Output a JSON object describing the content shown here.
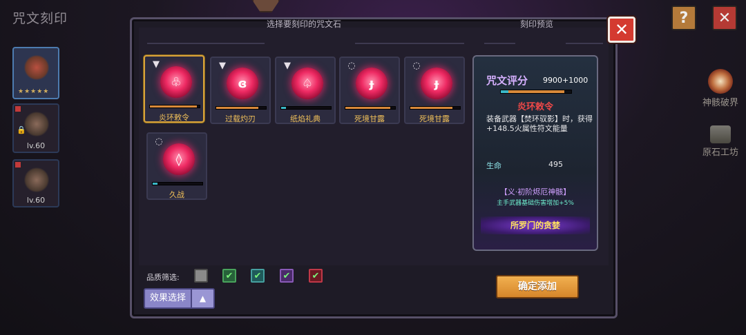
{
  "screen": {
    "title": "咒文刻印"
  },
  "top_buttons": {
    "help": "?",
    "close": "✕"
  },
  "heroes": [
    {
      "stars": "★★★★★",
      "selected": true
    },
    {
      "level": "lv.60",
      "locked": true
    },
    {
      "level": "lv.60",
      "locked": false
    }
  ],
  "side_links": [
    {
      "label": "神骸破界",
      "icon": "skull-orb-icon"
    },
    {
      "label": "原石工坊",
      "icon": "anvil-icon"
    }
  ],
  "panel": {
    "select_title": "选择要刻印的咒文石",
    "preview_title": "刻印预览",
    "close_label": "✕"
  },
  "runes": [
    {
      "name": "炎环敕令",
      "glyph": "♧",
      "top_icon": "arrow-down-icon",
      "selected": true,
      "fill": 0.95,
      "bar_color": "#d8893a"
    },
    {
      "name": "过载灼刃",
      "glyph": "ɞ",
      "top_icon": "arrow-down-icon",
      "selected": false,
      "fill": 0.85,
      "bar_color": "#d8893a"
    },
    {
      "name": "纸焰礼典",
      "glyph": "♤",
      "top_icon": "arrow-down-icon",
      "selected": false,
      "fill": 0.1,
      "bar_color": "#3ab8c8"
    },
    {
      "name": "死境甘露",
      "glyph": "ɟ",
      "top_icon": "ring-icon",
      "selected": false,
      "fill": 0.9,
      "bar_color": "#d8893a"
    },
    {
      "name": "死境甘露",
      "glyph": "ɟ",
      "top_icon": "ring-icon",
      "selected": false,
      "fill": 0.85,
      "bar_color": "#d8893a"
    },
    {
      "name": "久战",
      "glyph": "◊",
      "top_icon": "ring-icon",
      "selected": false,
      "fill": 0.1,
      "bar_color": "#3ab8c8"
    }
  ],
  "preview": {
    "score_label": "咒文评分",
    "score_value": "9900+1000",
    "score_fill": 0.9,
    "rune_name": "炎环敕令",
    "description": "装备武器【焚环驭影】时，获得+148.5火属性符文能量",
    "stat_name": "生命",
    "stat_value": "495",
    "set_name": "【义·初阶烬厄神骸】",
    "set_bonus": "主手武器基础伤害增加+5%",
    "owner": "所罗门的贪婪"
  },
  "footer": {
    "filter_label": "品质筛选:",
    "filters": [
      {
        "checked": false,
        "color": "gray"
      },
      {
        "checked": true,
        "color": "green"
      },
      {
        "checked": true,
        "color": "teal"
      },
      {
        "checked": true,
        "color": "purple"
      },
      {
        "checked": true,
        "color": "red"
      }
    ],
    "effect_button": "效果选择",
    "effect_toggle": "▲",
    "confirm_button": "确定添加",
    "check_mark": "✔"
  }
}
